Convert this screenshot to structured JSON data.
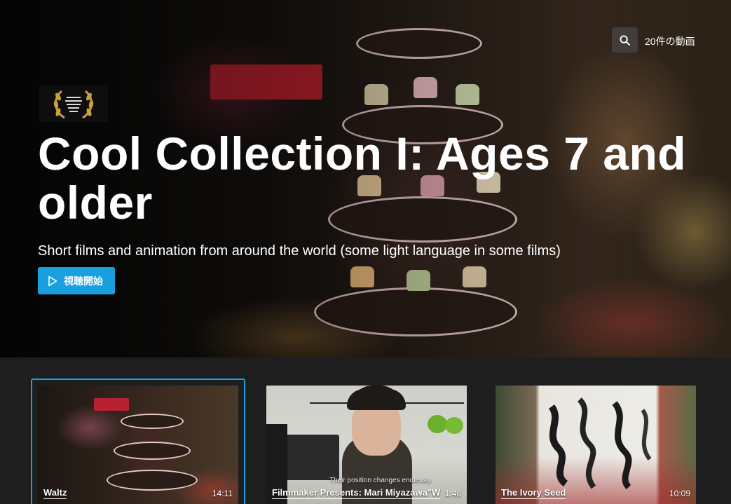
{
  "header": {
    "video_count": "20件の動画",
    "search_icon": "search-icon"
  },
  "hero": {
    "title": "Cool Collection I: Ages 7 and older",
    "subtitle": "Short films and animation from around the world (some light language in some films)",
    "play_label": "視聴開始",
    "play_icon": "play-icon",
    "award_icon": "laurel-award-icon"
  },
  "videos": [
    {
      "title": "Waltz",
      "duration": "14:11"
    },
    {
      "title": "Filmmaker Presents: Mari Miyazawa\"W",
      "duration": "1:46",
      "caption": "Their position changes endlessly."
    },
    {
      "title": "The Ivory Seed",
      "duration": "10:09"
    }
  ],
  "colors": {
    "accent": "#1aa0e0",
    "background": "#1e1e1e"
  }
}
